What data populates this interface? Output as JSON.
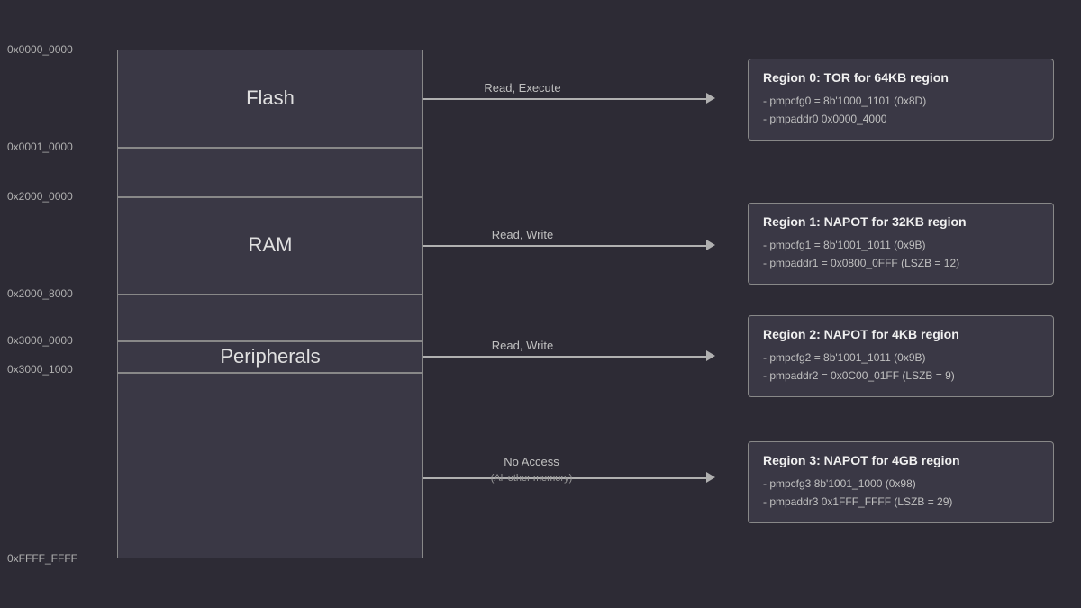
{
  "addresses": {
    "addr0": "0x0000_0000",
    "addr1": "0x0001_0000",
    "addr2": "0x2000_0000",
    "addr3": "0x2000_8000",
    "addr4": "0x3000_0000",
    "addr5": "0x3000_1000",
    "addr6": "0xFFFF_FFFF"
  },
  "segments": {
    "flash_label": "Flash",
    "ram_label": "RAM",
    "peripherals_label": "Peripherals"
  },
  "arrows": {
    "arrow0_label": "Read, Execute",
    "arrow1_label": "Read, Write",
    "arrow2_label": "Read, Write",
    "arrow3_label": "No Access",
    "arrow3_sub": "(All other memory)"
  },
  "regions": {
    "r0_title": "Region 0: TOR for 64KB region",
    "r0_line1": "- pmpcfg0 = 8b'1000_1101 (0x8D)",
    "r0_line2": "- pmpaddr0 0x0000_4000",
    "r1_title": "Region 1: NAPOT for 32KB region",
    "r1_line1": "- pmpcfg1 = 8b'1001_1011 (0x9B)",
    "r1_line2": "- pmpaddr1 = 0x0800_0FFF (LSZB = 12)",
    "r2_title": "Region 2: NAPOT for 4KB region",
    "r2_line1": "- pmpcfg2 = 8b'1001_1011 (0x9B)",
    "r2_line2": "- pmpaddr2 = 0x0C00_01FF (LSZB = 9)",
    "r3_title": "Region 3: NAPOT for 4GB region",
    "r3_line1": "- pmpcfg3 8b'1001_1000 (0x98)",
    "r3_line2": "- pmpaddr3 0x1FFF_FFFF (LSZB = 29)"
  }
}
